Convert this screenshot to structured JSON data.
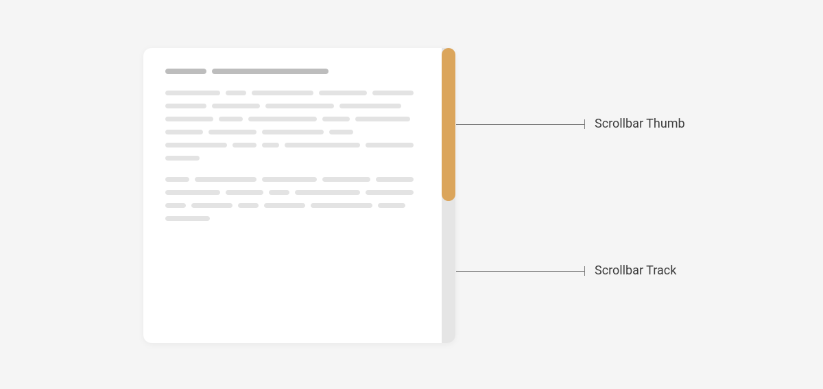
{
  "labels": {
    "thumb": "Scrollbar Thumb",
    "track": "Scrollbar Track"
  },
  "colors": {
    "background": "#f5f5f5",
    "card": "#ffffff",
    "heading_bar": "#bdbdbd",
    "text_bar": "#e3e3e3",
    "scrollbar_track": "#e5e5e5",
    "scrollbar_thumb": "#dba55b",
    "callout_line": "#7a7a7a",
    "label_text": "#3c3c3c"
  }
}
